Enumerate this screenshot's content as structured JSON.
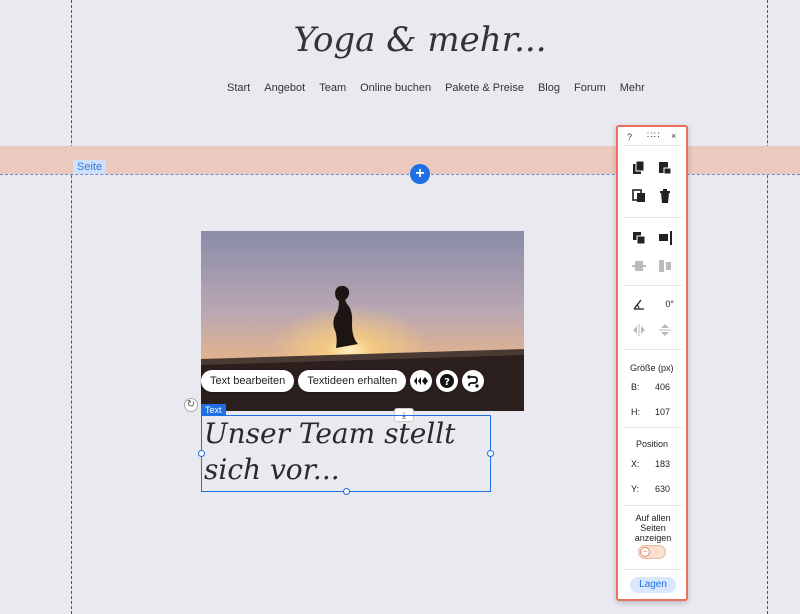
{
  "site": {
    "title": "Yoga & mehr..."
  },
  "nav": {
    "items": [
      "Start",
      "Angebot",
      "Team",
      "Online buchen",
      "Pakete & Preise",
      "Blog",
      "Forum",
      "Mehr"
    ]
  },
  "editor": {
    "page_label": "Seite",
    "add_button": "+",
    "text_tag": "Text",
    "toolbar": {
      "edit_text": "Text bearbeiten",
      "text_ideas": "Textideen erhalten"
    },
    "stretch_symbol": "⤓",
    "rotate_symbol": "↻"
  },
  "text_element": {
    "heading": "Unser Team stellt sich vor..."
  },
  "panel": {
    "help": "?",
    "drag": "∷∷",
    "close": "×",
    "rotation": "0°",
    "size_title": "Größe (px)",
    "width_label": "B:",
    "width_value": "406",
    "height_label": "H:",
    "height_value": "107",
    "position_title": "Position",
    "x_label": "X:",
    "x_value": "183",
    "y_label": "Y:",
    "y_value": "630",
    "show_all_pages": "Auf allen Seiten anzeigen",
    "toggle_symbol": "–",
    "layers_button": "Lagen"
  },
  "colors": {
    "accent": "#1f6fe5",
    "panel_border": "#e8705c",
    "header_band": "#ecc9bf",
    "canvas_bg": "#eae9f0"
  }
}
